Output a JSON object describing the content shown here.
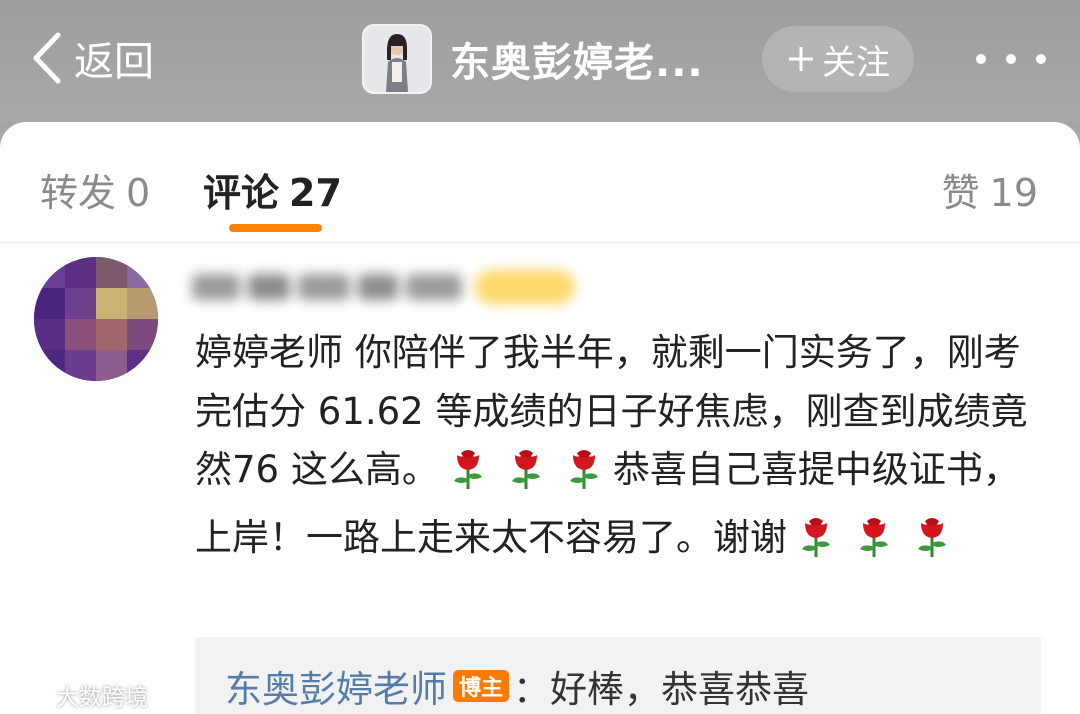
{
  "header": {
    "back_label": "返回",
    "author_name": "东奥彭婷老...",
    "follow_label": "关注",
    "more_icon": "more-icon"
  },
  "tabs": [
    {
      "label": "转发",
      "count": "0"
    },
    {
      "label": "评论",
      "count": "27"
    },
    {
      "label": "赞",
      "count": "19"
    }
  ],
  "comment": {
    "text_1": "婷婷老师 你陪伴了我半年，就剩一门实务了，刚考完估分 61.62 等成绩的日子好焦虑，刚查到成绩竟然76 这么高。",
    "text_2": "恭喜自己喜提中级证书，上岸！一路上走来太不容易了。谢谢",
    "emoji": "rose"
  },
  "reply": {
    "name": "东奥彭婷老师",
    "tag": "博主",
    "text": "：好棒，恭喜恭喜"
  },
  "colors": {
    "accent": "#ff8200",
    "link": "#557da8",
    "tag": "#ff7a00"
  },
  "watermark": {
    "text": "大数跨境"
  }
}
